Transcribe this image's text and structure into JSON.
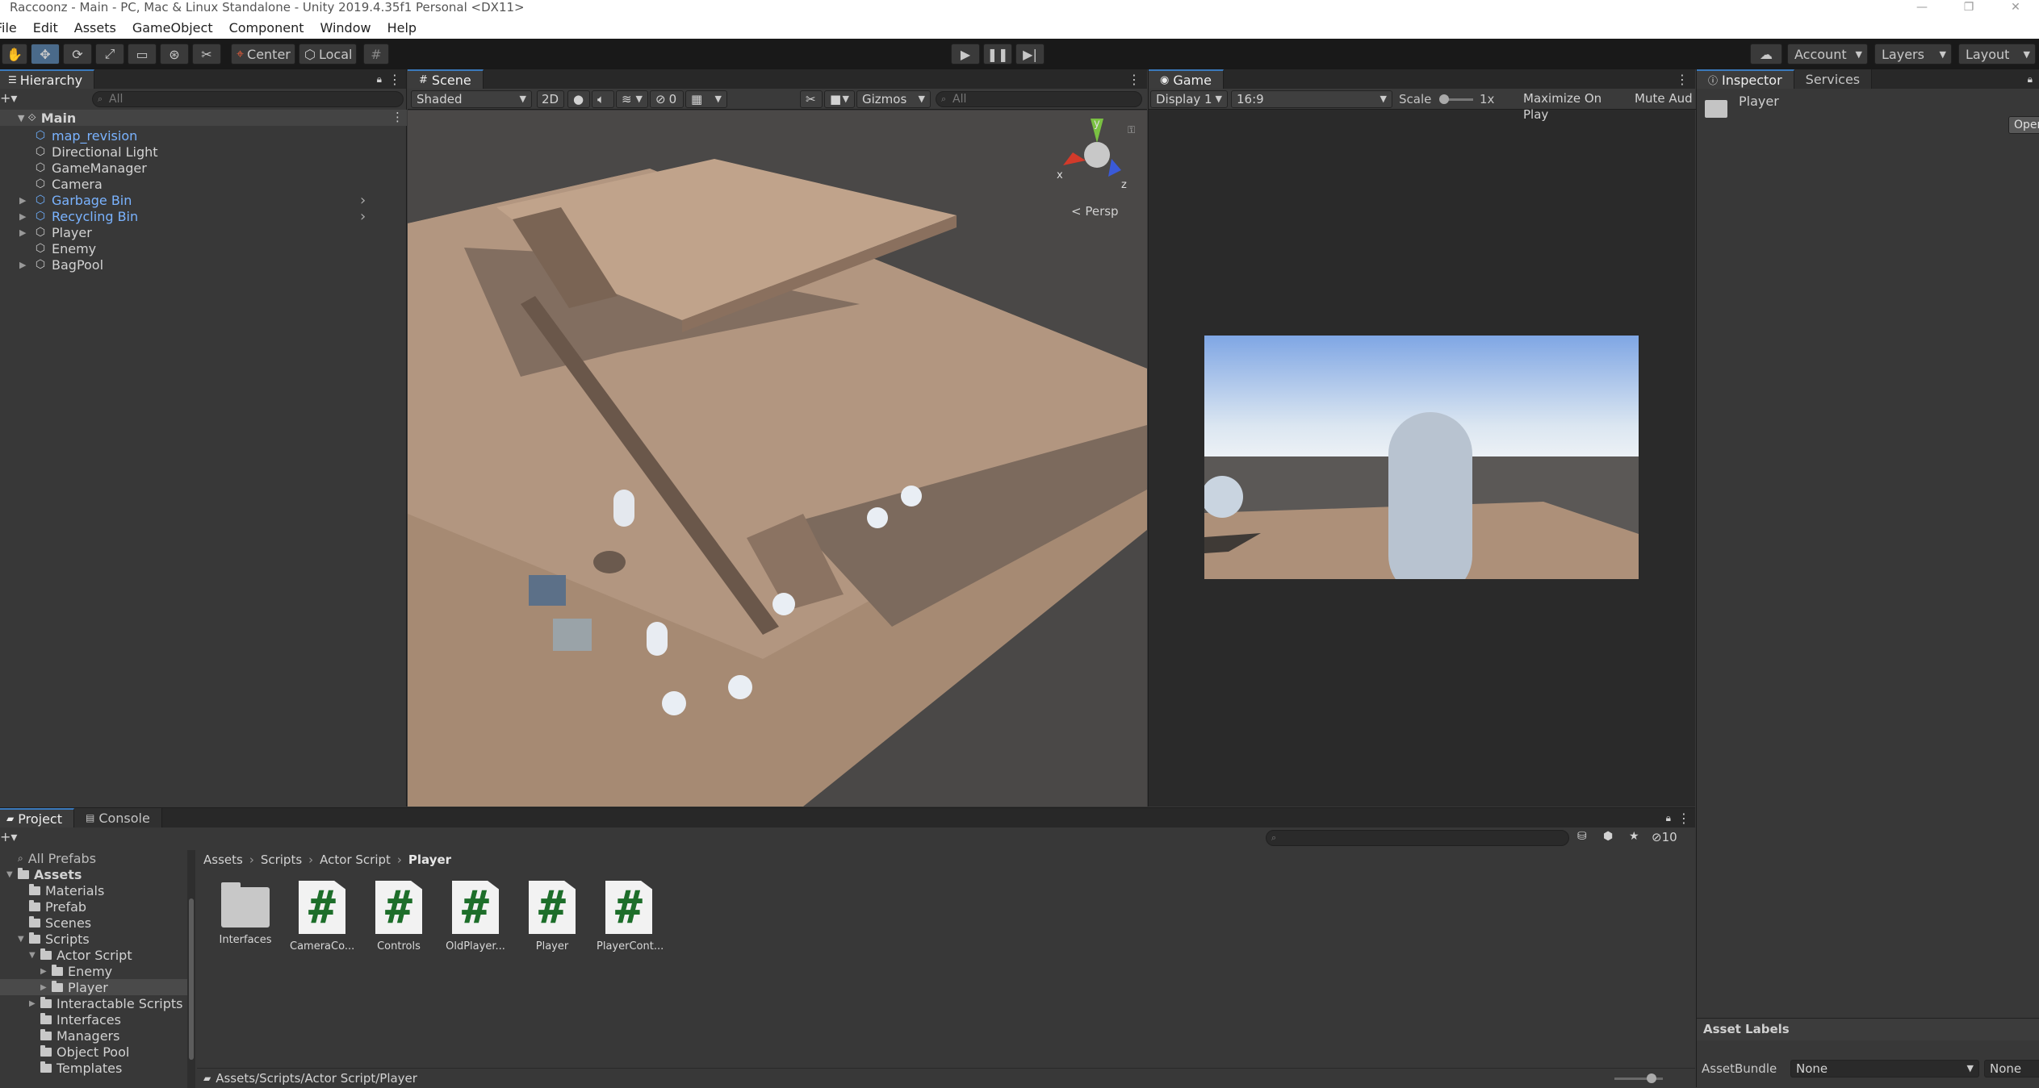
{
  "window": {
    "title": "Raccoonz - Main - PC, Mac & Linux Standalone - Unity 2019.4.35f1 Personal <DX11>",
    "controls": [
      "—",
      "❐",
      "✕"
    ]
  },
  "menu": [
    "File",
    "Edit",
    "Assets",
    "GameObject",
    "Component",
    "Window",
    "Help"
  ],
  "toolbar": {
    "pivot_label": "Center",
    "space_label": "Local",
    "account_label": "Account",
    "layers_label": "Layers",
    "layout_label": "Layout"
  },
  "hierarchy": {
    "tab": "Hierarchy",
    "search_placeholder": "All",
    "scene": "Main",
    "items": [
      {
        "label": "map_revision",
        "prefab": true,
        "expandable": false
      },
      {
        "label": "Directional Light",
        "prefab": false,
        "expandable": false
      },
      {
        "label": "GameManager",
        "prefab": false,
        "expandable": false
      },
      {
        "label": "Camera",
        "prefab": false,
        "expandable": false
      },
      {
        "label": "Garbage Bin",
        "prefab": true,
        "expandable": true
      },
      {
        "label": "Recycling Bin",
        "prefab": true,
        "expandable": true
      },
      {
        "label": "Player",
        "prefab": false,
        "expandable": true
      },
      {
        "label": "Enemy",
        "prefab": false,
        "expandable": false
      },
      {
        "label": "BagPool",
        "prefab": false,
        "expandable": true
      }
    ]
  },
  "scene_view": {
    "tab": "Scene",
    "shading": "Shaded",
    "mode_2d": "2D",
    "hidden_count": "0",
    "gizmos": "Gizmos",
    "search_placeholder": "All",
    "persp_label": "< Persp",
    "axis_labels": {
      "x": "x",
      "y": "y",
      "z": "z"
    }
  },
  "game_view": {
    "tab": "Game",
    "display": "Display 1",
    "aspect": "16:9",
    "scale_label": "Scale",
    "scale_value": "1x",
    "maximize": "Maximize On Play",
    "mute": "Mute Aud"
  },
  "inspector": {
    "tab": "Inspector",
    "services_tab": "Services",
    "object_name": "Player",
    "open_button": "Open",
    "asset_labels": "Asset Labels",
    "asset_bundle_label": "AssetBundle",
    "asset_bundle_value": "None",
    "asset_bundle_variant": "None"
  },
  "project": {
    "tab": "Project",
    "console_tab": "Console",
    "hidden_count": "10",
    "breadcrumb": [
      "Assets",
      "Scripts",
      "Actor Script",
      "Player"
    ],
    "path": "Assets/Scripts/Actor Script/Player",
    "all_prefabs": "All Prefabs",
    "tree": [
      {
        "label": "Assets",
        "indent": 0,
        "bold": true,
        "open": true
      },
      {
        "label": "Materials",
        "indent": 1
      },
      {
        "label": "Prefab",
        "indent": 1
      },
      {
        "label": "Scenes",
        "indent": 1
      },
      {
        "label": "Scripts",
        "indent": 1,
        "open": true
      },
      {
        "label": "Actor Script",
        "indent": 2,
        "open": true
      },
      {
        "label": "Enemy",
        "indent": 3,
        "arrow": true
      },
      {
        "label": "Player",
        "indent": 3,
        "arrow": true,
        "selected": true
      },
      {
        "label": "Interactable Scripts",
        "indent": 2,
        "arrow": true
      },
      {
        "label": "Interfaces",
        "indent": 2
      },
      {
        "label": "Managers",
        "indent": 2
      },
      {
        "label": "Object Pool",
        "indent": 2
      },
      {
        "label": "Templates",
        "indent": 2
      }
    ],
    "assets": [
      {
        "label": "Interfaces",
        "kind": "folder"
      },
      {
        "label": "CameraCo...",
        "kind": "script"
      },
      {
        "label": "Controls",
        "kind": "script"
      },
      {
        "label": "OldPlayer...",
        "kind": "script"
      },
      {
        "label": "Player",
        "kind": "script"
      },
      {
        "label": "PlayerCont...",
        "kind": "script"
      }
    ]
  }
}
